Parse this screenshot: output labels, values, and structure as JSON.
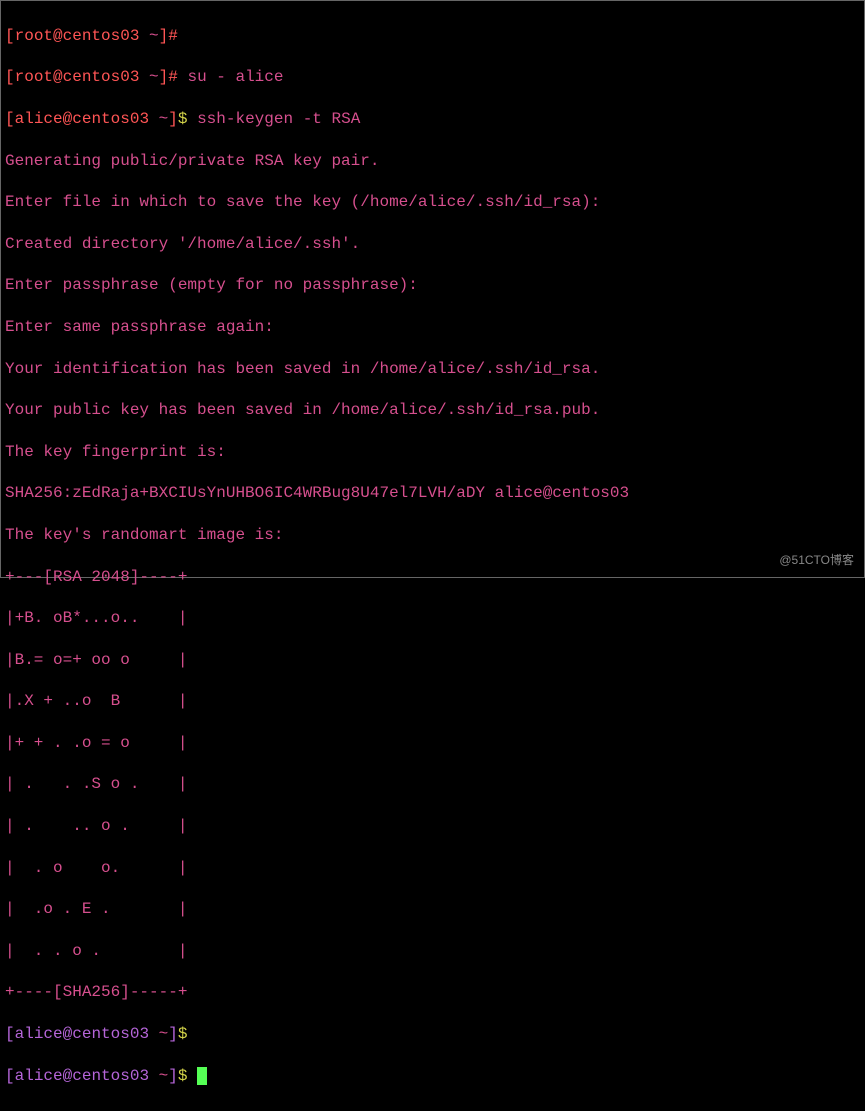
{
  "lines": {
    "l1": {
      "bracket_open": "[",
      "user": "root",
      "at": "@",
      "host": "centos03",
      "path": " ~",
      "bracket_close": "]",
      "prompt": "#",
      "cmd": ""
    },
    "l2": {
      "bracket_open": "[",
      "user": "root",
      "at": "@",
      "host": "centos03",
      "path": " ~",
      "bracket_close": "]",
      "prompt": "#",
      "cmd": " su - alice"
    },
    "l3": {
      "bracket_open": "[",
      "user": "alice",
      "at": "@",
      "host": "centos03",
      "path": " ~",
      "bracket_close": "]",
      "prompt": "$",
      "cmd": " ssh-keygen -t RSA"
    },
    "l4": "Generating public/private RSA key pair.",
    "l5": "Enter file in which to save the key (/home/alice/.ssh/id_rsa):",
    "l6": "Created directory '/home/alice/.ssh'.",
    "l7": "Enter passphrase (empty for no passphrase):",
    "l8": "Enter same passphrase again:",
    "l9": "Your identification has been saved in /home/alice/.ssh/id_rsa.",
    "l10": "Your public key has been saved in /home/alice/.ssh/id_rsa.pub.",
    "l11": "The key fingerprint is:",
    "l12": "SHA256:zEdRaja+BXCIUsYnUHBO6IC4WRBug8U47el7LVH/aDY alice@centos03",
    "l13": "The key's randomart image is:",
    "l14": "+---[RSA 2048]----+",
    "l15": "|+B. oB*...o..    |",
    "l16": "|B.= o=+ oo o     |",
    "l17": "|.X + ..o  B      |",
    "l18": "|+ + . .o = o     |",
    "l19": "| .   . .S o .    |",
    "l20": "| .    .. o .     |",
    "l21": "|  . o    o.      |",
    "l22": "|  .o . E .       |",
    "l23": "|  . . o .        |",
    "l24": "+----[SHA256]-----+",
    "l25": {
      "bracket_open": "[",
      "user": "alice",
      "at": "@",
      "host": "centos03",
      "path": " ~",
      "bracket_close": "]",
      "prompt": "$",
      "cmd": ""
    },
    "l26": {
      "bracket_open": "[",
      "user": "alice",
      "at": "@",
      "host": "centos03",
      "path": " ~",
      "bracket_close": "]",
      "prompt": "$",
      "cmd": " "
    }
  },
  "watermark": "@51CTO博客"
}
